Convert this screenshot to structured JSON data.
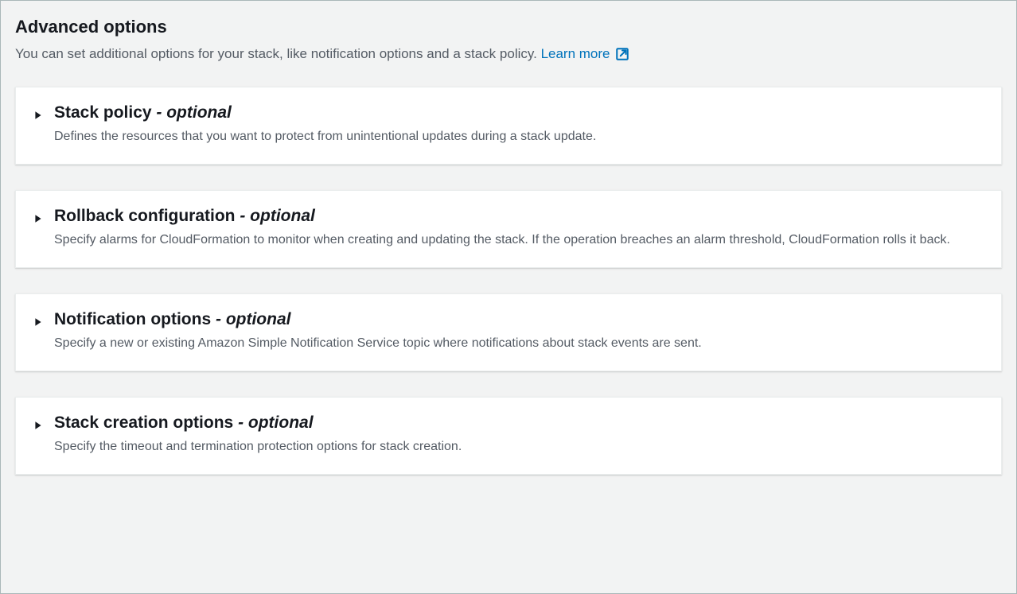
{
  "header": {
    "title": "Advanced options",
    "description": "You can set additional options for your stack, like notification options and a stack policy.",
    "learn_more_label": "Learn more"
  },
  "sections": [
    {
      "title": "Stack policy",
      "optional_label": "- optional",
      "description": "Defines the resources that you want to protect from unintentional updates during a stack update."
    },
    {
      "title": "Rollback configuration",
      "optional_label": "- optional",
      "description": "Specify alarms for CloudFormation to monitor when creating and updating the stack. If the operation breaches an alarm threshold, CloudFormation rolls it back."
    },
    {
      "title": "Notification options",
      "optional_label": "- optional",
      "description": "Specify a new or existing Amazon Simple Notification Service topic where notifications about stack events are sent."
    },
    {
      "title": "Stack creation options",
      "optional_label": "- optional",
      "description": "Specify the timeout and termination protection options for stack creation."
    }
  ]
}
